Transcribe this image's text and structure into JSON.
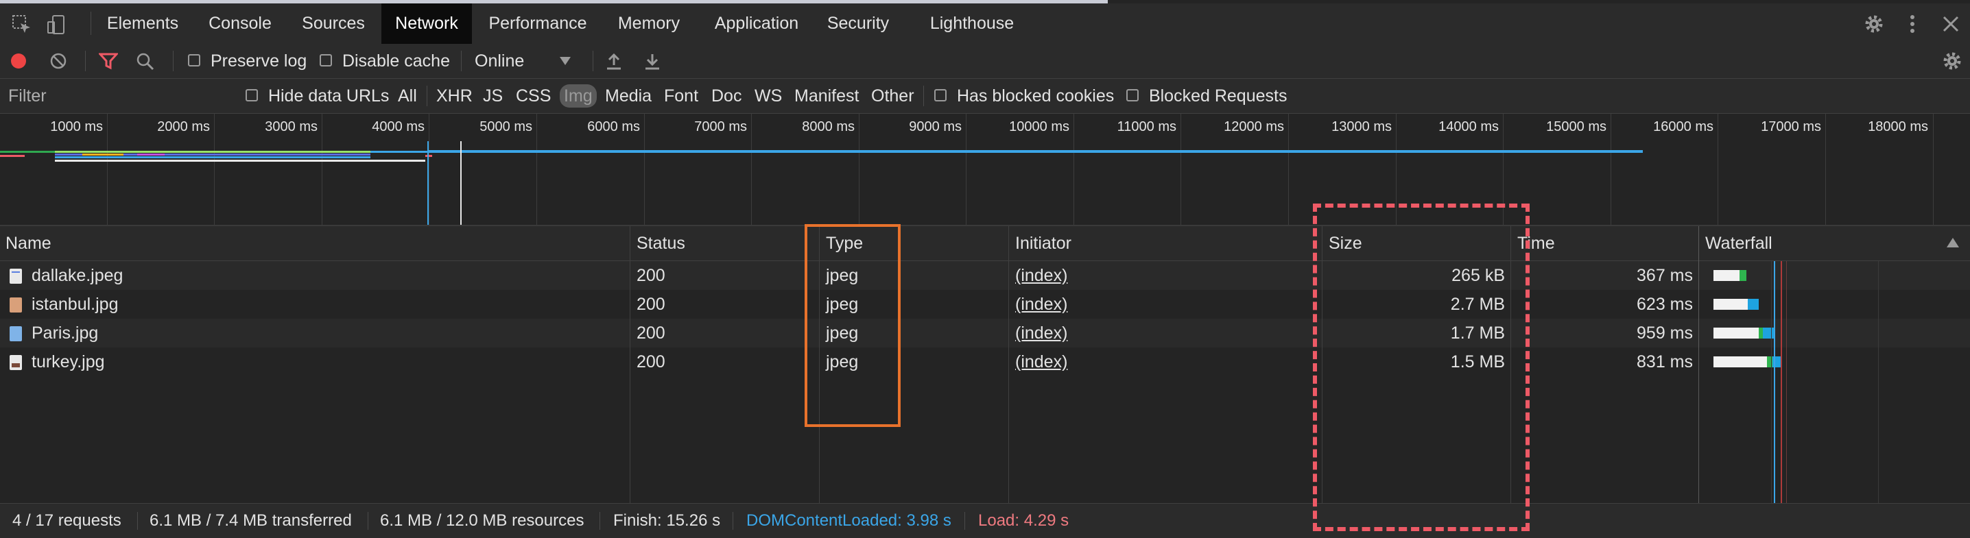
{
  "tabs": [
    "Elements",
    "Console",
    "Sources",
    "Network",
    "Performance",
    "Memory",
    "Application",
    "Security",
    "Lighthouse"
  ],
  "active_tab": "Network",
  "toolbar": {
    "preserve_log": "Preserve log",
    "disable_cache": "Disable cache",
    "throttling": "Online"
  },
  "filterbar": {
    "filter_placeholder": "Filter",
    "hide_data_urls": "Hide data URLs",
    "types": [
      "All",
      "XHR",
      "JS",
      "CSS",
      "Img",
      "Media",
      "Font",
      "Doc",
      "WS",
      "Manifest",
      "Other"
    ],
    "active_type": "Img",
    "has_blocked_cookies": "Has blocked cookies",
    "blocked_requests": "Blocked Requests"
  },
  "overview": {
    "ticks": [
      "1000 ms",
      "2000 ms",
      "3000 ms",
      "4000 ms",
      "5000 ms",
      "6000 ms",
      "7000 ms",
      "8000 ms",
      "9000 ms",
      "10000 ms",
      "11000 ms",
      "12000 ms",
      "13000 ms",
      "14000 ms",
      "15000 ms",
      "16000 ms",
      "17000 ms",
      "18000 ms"
    ]
  },
  "columns": {
    "name": "Name",
    "status": "Status",
    "type": "Type",
    "initiator": "Initiator",
    "size": "Size",
    "time": "Time",
    "waterfall": "Waterfall"
  },
  "rows": [
    {
      "name": "dallake.jpeg",
      "status": "200",
      "type": "jpeg",
      "initiator": "(index)",
      "size": "265 kB",
      "time": "367 ms"
    },
    {
      "name": "istanbul.jpg",
      "status": "200",
      "type": "jpeg",
      "initiator": "(index)",
      "size": "2.7 MB",
      "time": "623 ms"
    },
    {
      "name": "Paris.jpg",
      "status": "200",
      "type": "jpeg",
      "initiator": "(index)",
      "size": "1.7 MB",
      "time": "959 ms"
    },
    {
      "name": "turkey.jpg",
      "status": "200",
      "type": "jpeg",
      "initiator": "(index)",
      "size": "1.5 MB",
      "time": "831 ms"
    }
  ],
  "status": {
    "requests": "4 / 17 requests",
    "transferred": "6.1 MB / 7.4 MB transferred",
    "resources": "6.1 MB / 12.0 MB resources",
    "finish": "Finish: 15.26 s",
    "dom_content_loaded": "DOMContentLoaded: 3.98 s",
    "load": "Load: 4.29 s"
  },
  "colors": {
    "dom_content_loaded": "#3ba6e8",
    "load": "#ee5a66",
    "record": "#ee4444",
    "filter_active": "#ee5a66"
  }
}
